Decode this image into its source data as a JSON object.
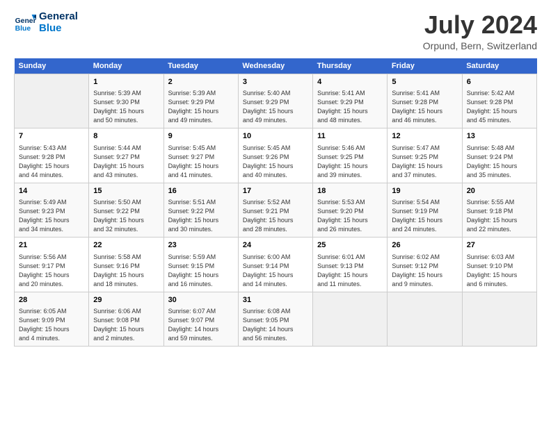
{
  "header": {
    "logo_line1": "General",
    "logo_line2": "Blue",
    "title": "July 2024",
    "location": "Orpund, Bern, Switzerland"
  },
  "weekdays": [
    "Sunday",
    "Monday",
    "Tuesday",
    "Wednesday",
    "Thursday",
    "Friday",
    "Saturday"
  ],
  "weeks": [
    [
      {
        "day": "",
        "info": ""
      },
      {
        "day": "1",
        "info": "Sunrise: 5:39 AM\nSunset: 9:30 PM\nDaylight: 15 hours\nand 50 minutes."
      },
      {
        "day": "2",
        "info": "Sunrise: 5:39 AM\nSunset: 9:29 PM\nDaylight: 15 hours\nand 49 minutes."
      },
      {
        "day": "3",
        "info": "Sunrise: 5:40 AM\nSunset: 9:29 PM\nDaylight: 15 hours\nand 49 minutes."
      },
      {
        "day": "4",
        "info": "Sunrise: 5:41 AM\nSunset: 9:29 PM\nDaylight: 15 hours\nand 48 minutes."
      },
      {
        "day": "5",
        "info": "Sunrise: 5:41 AM\nSunset: 9:28 PM\nDaylight: 15 hours\nand 46 minutes."
      },
      {
        "day": "6",
        "info": "Sunrise: 5:42 AM\nSunset: 9:28 PM\nDaylight: 15 hours\nand 45 minutes."
      }
    ],
    [
      {
        "day": "7",
        "info": "Sunrise: 5:43 AM\nSunset: 9:28 PM\nDaylight: 15 hours\nand 44 minutes."
      },
      {
        "day": "8",
        "info": "Sunrise: 5:44 AM\nSunset: 9:27 PM\nDaylight: 15 hours\nand 43 minutes."
      },
      {
        "day": "9",
        "info": "Sunrise: 5:45 AM\nSunset: 9:27 PM\nDaylight: 15 hours\nand 41 minutes."
      },
      {
        "day": "10",
        "info": "Sunrise: 5:45 AM\nSunset: 9:26 PM\nDaylight: 15 hours\nand 40 minutes."
      },
      {
        "day": "11",
        "info": "Sunrise: 5:46 AM\nSunset: 9:25 PM\nDaylight: 15 hours\nand 39 minutes."
      },
      {
        "day": "12",
        "info": "Sunrise: 5:47 AM\nSunset: 9:25 PM\nDaylight: 15 hours\nand 37 minutes."
      },
      {
        "day": "13",
        "info": "Sunrise: 5:48 AM\nSunset: 9:24 PM\nDaylight: 15 hours\nand 35 minutes."
      }
    ],
    [
      {
        "day": "14",
        "info": "Sunrise: 5:49 AM\nSunset: 9:23 PM\nDaylight: 15 hours\nand 34 minutes."
      },
      {
        "day": "15",
        "info": "Sunrise: 5:50 AM\nSunset: 9:22 PM\nDaylight: 15 hours\nand 32 minutes."
      },
      {
        "day": "16",
        "info": "Sunrise: 5:51 AM\nSunset: 9:22 PM\nDaylight: 15 hours\nand 30 minutes."
      },
      {
        "day": "17",
        "info": "Sunrise: 5:52 AM\nSunset: 9:21 PM\nDaylight: 15 hours\nand 28 minutes."
      },
      {
        "day": "18",
        "info": "Sunrise: 5:53 AM\nSunset: 9:20 PM\nDaylight: 15 hours\nand 26 minutes."
      },
      {
        "day": "19",
        "info": "Sunrise: 5:54 AM\nSunset: 9:19 PM\nDaylight: 15 hours\nand 24 minutes."
      },
      {
        "day": "20",
        "info": "Sunrise: 5:55 AM\nSunset: 9:18 PM\nDaylight: 15 hours\nand 22 minutes."
      }
    ],
    [
      {
        "day": "21",
        "info": "Sunrise: 5:56 AM\nSunset: 9:17 PM\nDaylight: 15 hours\nand 20 minutes."
      },
      {
        "day": "22",
        "info": "Sunrise: 5:58 AM\nSunset: 9:16 PM\nDaylight: 15 hours\nand 18 minutes."
      },
      {
        "day": "23",
        "info": "Sunrise: 5:59 AM\nSunset: 9:15 PM\nDaylight: 15 hours\nand 16 minutes."
      },
      {
        "day": "24",
        "info": "Sunrise: 6:00 AM\nSunset: 9:14 PM\nDaylight: 15 hours\nand 14 minutes."
      },
      {
        "day": "25",
        "info": "Sunrise: 6:01 AM\nSunset: 9:13 PM\nDaylight: 15 hours\nand 11 minutes."
      },
      {
        "day": "26",
        "info": "Sunrise: 6:02 AM\nSunset: 9:12 PM\nDaylight: 15 hours\nand 9 minutes."
      },
      {
        "day": "27",
        "info": "Sunrise: 6:03 AM\nSunset: 9:10 PM\nDaylight: 15 hours\nand 6 minutes."
      }
    ],
    [
      {
        "day": "28",
        "info": "Sunrise: 6:05 AM\nSunset: 9:09 PM\nDaylight: 15 hours\nand 4 minutes."
      },
      {
        "day": "29",
        "info": "Sunrise: 6:06 AM\nSunset: 9:08 PM\nDaylight: 15 hours\nand 2 minutes."
      },
      {
        "day": "30",
        "info": "Sunrise: 6:07 AM\nSunset: 9:07 PM\nDaylight: 14 hours\nand 59 minutes."
      },
      {
        "day": "31",
        "info": "Sunrise: 6:08 AM\nSunset: 9:05 PM\nDaylight: 14 hours\nand 56 minutes."
      },
      {
        "day": "",
        "info": ""
      },
      {
        "day": "",
        "info": ""
      },
      {
        "day": "",
        "info": ""
      }
    ]
  ]
}
